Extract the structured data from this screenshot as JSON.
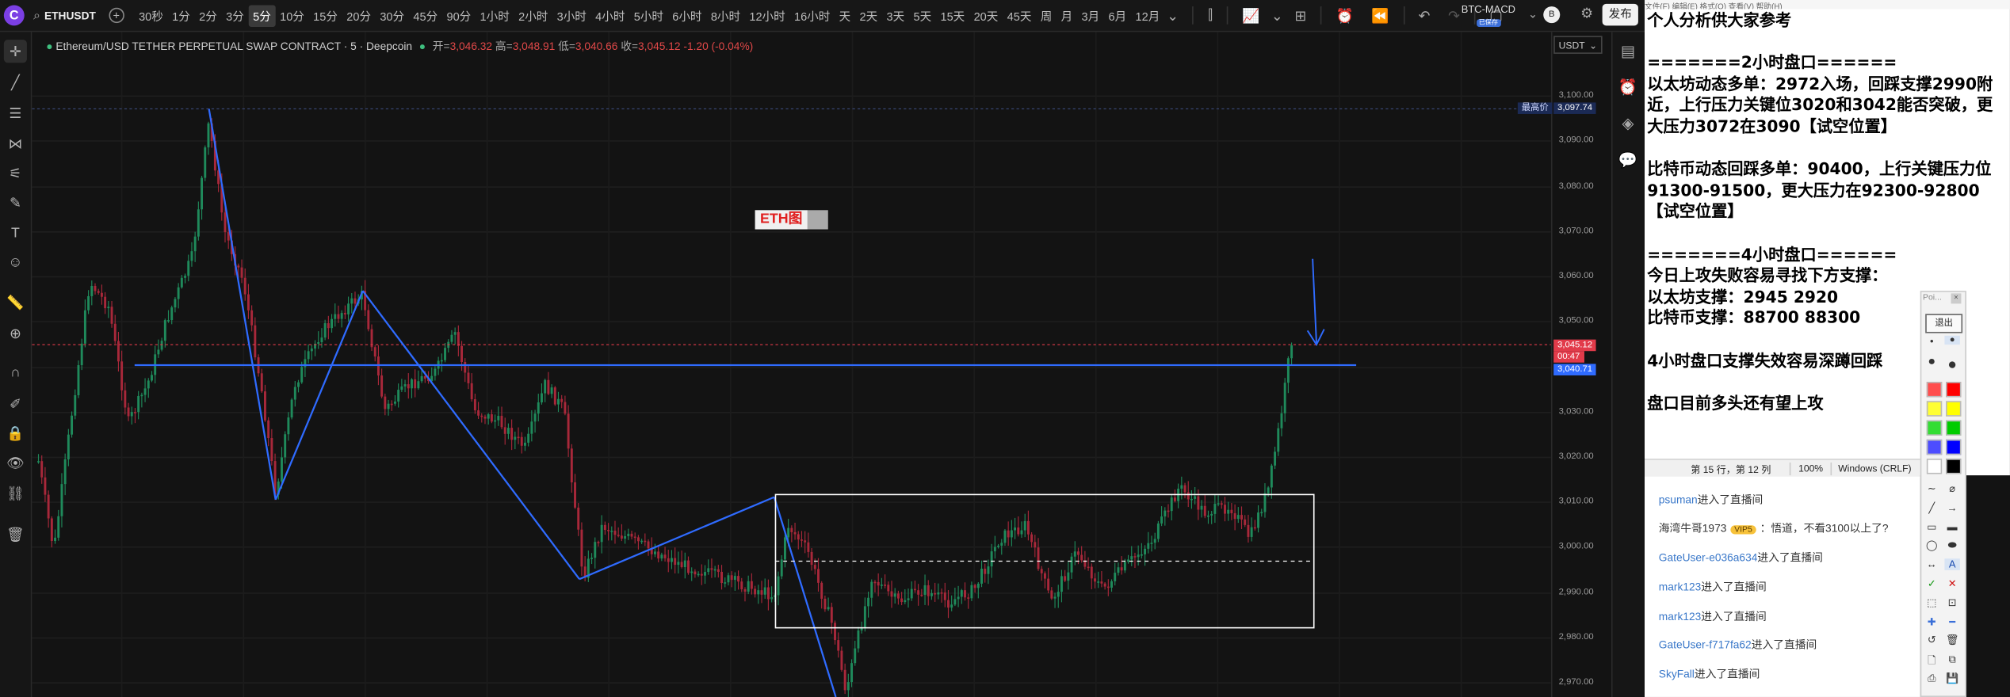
{
  "toolbar": {
    "symbol": "ETHUSDT",
    "timeframes": [
      "30秒",
      "1分",
      "2分",
      "3分",
      "5分",
      "10分",
      "15分",
      "20分",
      "30分",
      "45分",
      "90分",
      "1小时",
      "2小时",
      "3小时",
      "4小时",
      "5小时",
      "6小时",
      "8小时",
      "12小时",
      "16小时",
      "天",
      "2天",
      "3天",
      "5天",
      "15天",
      "20天",
      "45天",
      "周",
      "月",
      "3月",
      "6月",
      "12月"
    ],
    "active_timeframe": "5分",
    "indicator_name": "BTC-MACD",
    "indicator_badge": "已保存",
    "avatar_letter": "B",
    "publish_label": "发布"
  },
  "legend": {
    "title": "Ethereum/USD TETHER PERPETUAL SWAP CONTRACT · 5 · Deepcoin",
    "open_label": "开=",
    "open": "3,046.32",
    "high_label": "高=",
    "high": "3,048.91",
    "low_label": "低=",
    "low": "3,040.66",
    "close_label": "收=",
    "close": "3,045.12",
    "change": "-1.20 (-0.04%)"
  },
  "axis": {
    "currency": "USDT",
    "ticks": [
      "3,100.00",
      "3,090.00",
      "3,080.00",
      "3,070.00",
      "3,060.00",
      "3,050.00",
      "3,030.00",
      "3,020.00",
      "3,010.00",
      "3,000.00",
      "2,990.00",
      "2,980.00",
      "2,970.00"
    ],
    "highest_label": "最高价",
    "highest_value": "3,097.74",
    "last_price": "3,045.12",
    "countdown": "00:47",
    "line_price": "3,040.71"
  },
  "annotation": {
    "eth_badge": "ETH图"
  },
  "notepad": {
    "menu": "文件(F)   编辑(E)   格式(O)   查看(V)   帮助(H)",
    "lines": [
      "个人分析供大家参考",
      "",
      "=======2小时盘口======",
      "以太坊动态多单：2972入场，回踩支撑2990附近，上行压力关键位3020和3042能否突破，更大压力3072在3090【试空位置】",
      "",
      "比特币动态回踩多单：90400，上行关键压力位91300-91500，更大压力在92300-92800【试空位置】",
      "",
      "=======4小时盘口======",
      "今日上攻失败容易寻找下方支撑：",
      "以太坊支撑：2945 2920",
      "比特币支撑：88700 88300",
      "",
      "4小时盘口支撑失效容易深蹲回踩",
      "",
      "盘口目前多头还有望上攻"
    ],
    "status_position": "第 15 行，第 12 列",
    "status_zoom": "100%",
    "status_eol": "Windows (CRLF)"
  },
  "chat": {
    "messages": [
      {
        "user": "psuman",
        "text": "进入了直播间"
      },
      {
        "user": "海湾牛哥1973",
        "badge": "VIP5",
        "text": "：悟道，不看3100以上了?"
      },
      {
        "user": "GateUser-e036a634",
        "text": "进入了直播间"
      },
      {
        "user": "mark123",
        "text": "进入了直播间"
      },
      {
        "user": "mark123",
        "text": "进入了直播间"
      },
      {
        "user": "GateUser-f717fa62",
        "text": "进入了直播间"
      },
      {
        "user": "SkyFall",
        "text": "进入了直播间"
      }
    ]
  },
  "palette": {
    "header": "Poi...",
    "exit_label": "退出",
    "colors": [
      "#ff4d4d",
      "#ff0000",
      "#ffff33",
      "#ffff00",
      "#33dd33",
      "#00cc00",
      "#4d4dff",
      "#0000ff",
      "#ffffff",
      "#000000"
    ]
  },
  "colors": {
    "bull": "#1f8a5b",
    "bear": "#a8283a",
    "trendline": "#2f6bff",
    "price_label": "#e23b4a",
    "line_label": "#2f6bff"
  }
}
